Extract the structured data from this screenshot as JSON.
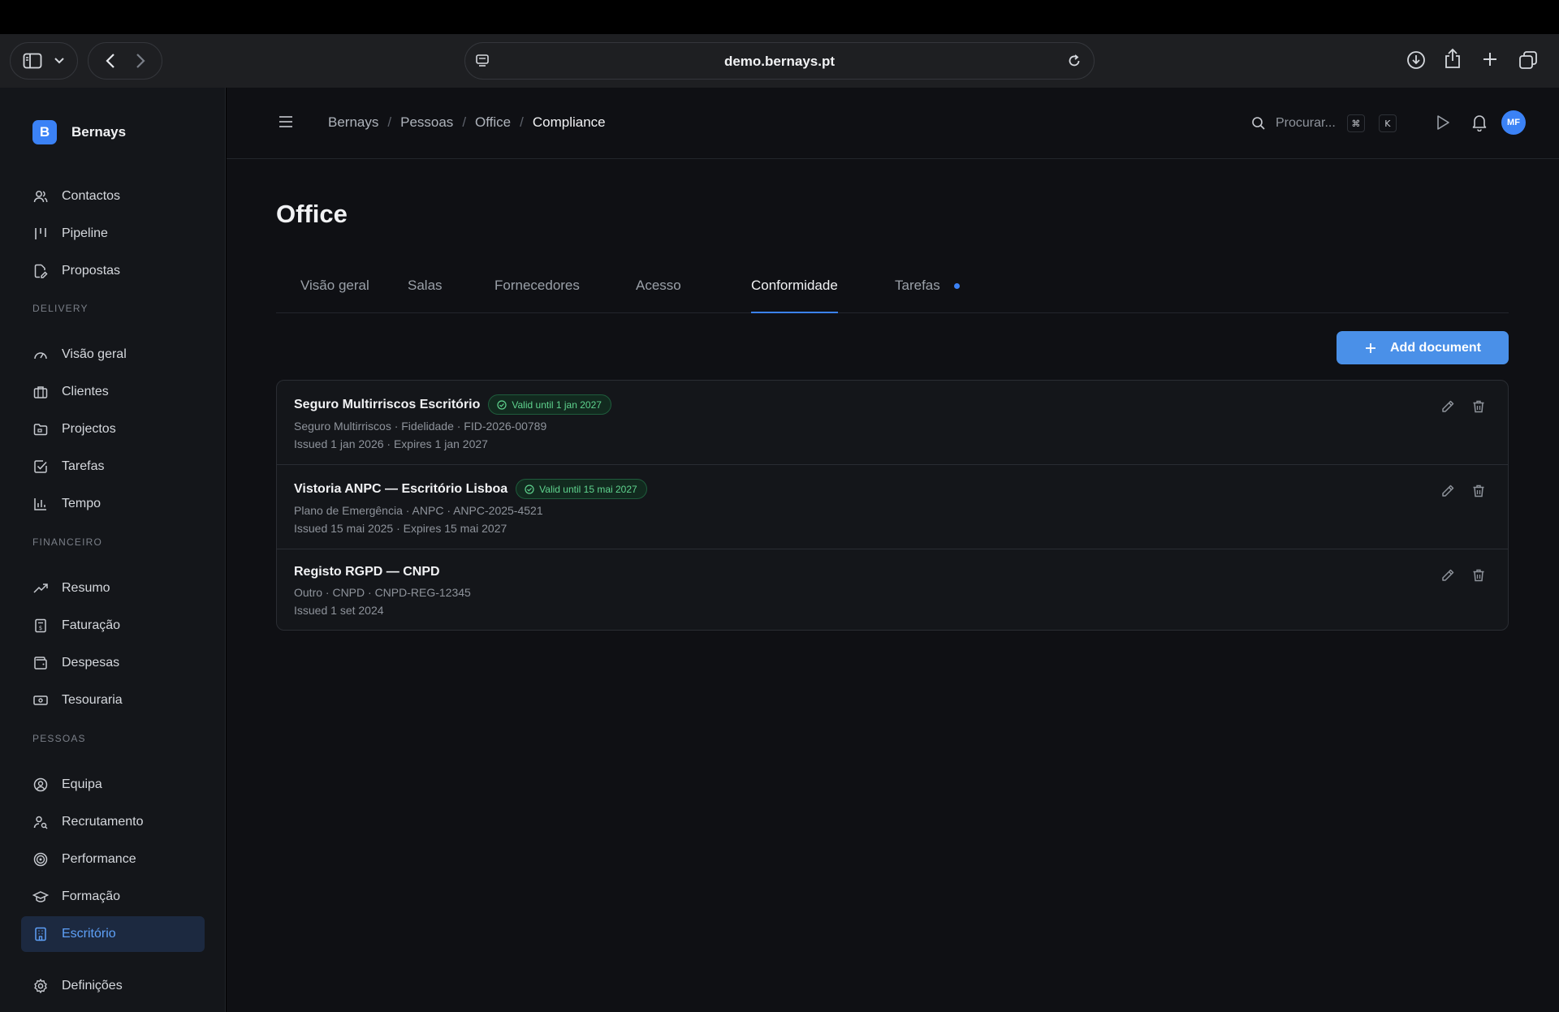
{
  "browser": {
    "url": "demo.bernays.pt"
  },
  "sidebar": {
    "brand": {
      "logo_letter": "B",
      "name": "Bernays"
    },
    "top_items": [
      {
        "label": "Contactos",
        "icon": "users-icon"
      },
      {
        "label": "Pipeline",
        "icon": "pipeline-icon"
      },
      {
        "label": "Propostas",
        "icon": "file-edit-icon"
      }
    ],
    "sections": [
      {
        "label": "DELIVERY",
        "items": [
          {
            "label": "Visão geral",
            "icon": "gauge-icon"
          },
          {
            "label": "Clientes",
            "icon": "briefcase-icon"
          },
          {
            "label": "Projectos",
            "icon": "folder-icon"
          },
          {
            "label": "Tarefas",
            "icon": "checkbox-icon"
          },
          {
            "label": "Tempo",
            "icon": "bar-chart-icon"
          }
        ]
      },
      {
        "label": "FINANCEIRO",
        "items": [
          {
            "label": "Resumo",
            "icon": "trending-up-icon"
          },
          {
            "label": "Faturação",
            "icon": "invoice-icon"
          },
          {
            "label": "Despesas",
            "icon": "wallet-icon"
          },
          {
            "label": "Tesouraria",
            "icon": "banknote-icon"
          }
        ]
      },
      {
        "label": "PESSOAS",
        "items": [
          {
            "label": "Equipa",
            "icon": "user-circle-icon"
          },
          {
            "label": "Recrutamento",
            "icon": "user-search-icon"
          },
          {
            "label": "Performance",
            "icon": "target-icon"
          },
          {
            "label": "Formação",
            "icon": "graduation-cap-icon"
          },
          {
            "label": "Escritório",
            "icon": "building-icon",
            "active": true
          }
        ]
      }
    ],
    "bottom_item": {
      "label": "Definições",
      "icon": "gear-icon"
    }
  },
  "header": {
    "breadcrumb": [
      "Bernays",
      "Pessoas",
      "Office",
      "Compliance"
    ],
    "search_placeholder": "Procurar...",
    "shortcut_keys": [
      "⌘",
      "K"
    ],
    "avatar_initials": "MF"
  },
  "page": {
    "title": "Office",
    "tabs": [
      {
        "label": "Visão geral"
      },
      {
        "label": "Salas"
      },
      {
        "label": "Fornecedores"
      },
      {
        "label": "Acesso"
      },
      {
        "label": "Conformidade",
        "active": true
      },
      {
        "label": "Tarefas",
        "dot": true
      }
    ],
    "add_button_label": "Add document",
    "documents": [
      {
        "title": "Seguro Multirriscos Escritório",
        "badge": "Valid until 1 jan 2027",
        "meta": "Seguro Multirriscos · Fidelidade · FID-2026-00789",
        "dates": "Issued 1 jan 2026 · Expires 1 jan 2027"
      },
      {
        "title": "Vistoria ANPC — Escritório Lisboa",
        "badge": "Valid until 15 mai 2027",
        "meta": "Plano de Emergência · ANPC · ANPC-2025-4521",
        "dates": "Issued 15 mai 2025 · Expires 15 mai 2027"
      },
      {
        "title": "Registo RGPD — CNPD",
        "badge": "",
        "meta": "Outro · CNPD · CNPD-REG-12345",
        "dates": "Issued 1 set 2024"
      }
    ]
  },
  "colors": {
    "accent": "#3b82f6",
    "success": "#5fd38e",
    "background": "#0f1014",
    "sidebar": "#14161a"
  }
}
